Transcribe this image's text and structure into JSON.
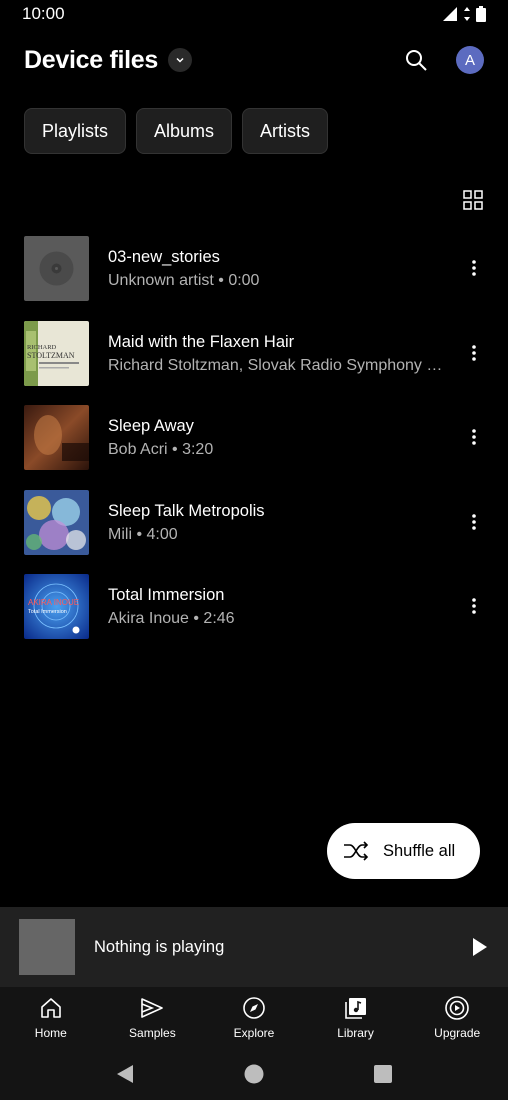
{
  "status_bar": {
    "time": "10:00"
  },
  "header": {
    "title": "Device files",
    "avatar_letter": "A"
  },
  "chips": [
    {
      "label": "Playlists"
    },
    {
      "label": "Albums"
    },
    {
      "label": "Artists"
    }
  ],
  "songs": [
    {
      "title": "03-new_stories",
      "subtitle": "Unknown artist • 0:00",
      "art": "vinyl-placeholder"
    },
    {
      "title": "Maid with the Flaxen Hair",
      "subtitle": "Richard Stoltzman, Slovak Radio Symphony …",
      "art": "richard-stoltzman-cover"
    },
    {
      "title": "Sleep Away",
      "subtitle": "Bob Acri • 3:20",
      "art": "sleep-away-cover"
    },
    {
      "title": "Sleep Talk Metropolis",
      "subtitle": "Mili • 4:00",
      "art": "sleep-talk-metropolis-cover"
    },
    {
      "title": "Total Immersion",
      "subtitle": "Akira Inoue • 2:46",
      "art": "total-immersion-cover"
    }
  ],
  "shuffle": {
    "label": "Shuffle all"
  },
  "mini_player": {
    "title": "Nothing is playing"
  },
  "bottom_nav": [
    {
      "label": "Home",
      "icon": "home-icon"
    },
    {
      "label": "Samples",
      "icon": "samples-icon"
    },
    {
      "label": "Explore",
      "icon": "explore-icon"
    },
    {
      "label": "Library",
      "icon": "library-icon"
    },
    {
      "label": "Upgrade",
      "icon": "upgrade-icon"
    }
  ],
  "art_text": {
    "stoltzman_name_1": "RICHARD",
    "stoltzman_name_2": "STOLTZMAN",
    "akira_inoue_1": "AKIRA INOUE",
    "akira_inoue_2": "Total Immersion"
  },
  "colors": {
    "background": "#000000",
    "avatar": "#5c6bc0",
    "chip": "#1f1f1f",
    "mini_player": "#212121",
    "nav": "#141414"
  }
}
